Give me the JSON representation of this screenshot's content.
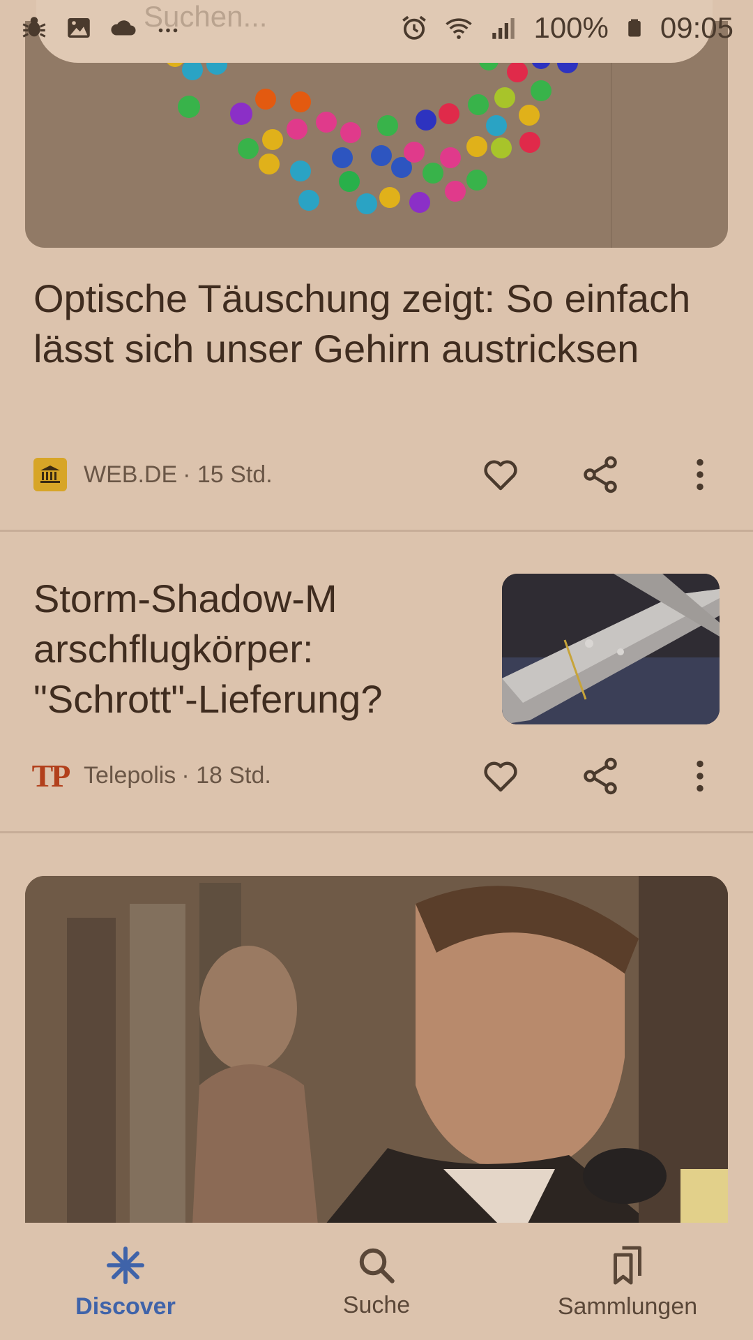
{
  "status_bar": {
    "battery": "100%",
    "time": "09:05"
  },
  "search": {
    "placeholder": "Suchen..."
  },
  "articles": [
    {
      "title": "Optische Täuschung zeigt: So einfach lässt sich unser Gehirn austricksen",
      "source": "WEB.DE",
      "age": "· 15 Std."
    },
    {
      "title": "Storm-Shadow-M arschflugkörper: \"Schrott\"-Lieferung?",
      "source": "Telepolis",
      "source_logo_text": "TP",
      "age": "· 18 Std."
    }
  ],
  "bottom_nav": {
    "items": [
      {
        "label": "Discover",
        "icon": "discover-asterisk-icon",
        "active": true
      },
      {
        "label": "Suche",
        "icon": "search-icon",
        "active": false
      },
      {
        "label": "Sammlungen",
        "icon": "bookmarks-icon",
        "active": false
      }
    ]
  },
  "colors": {
    "accent": "#3f63a9",
    "background": "#dcc3ad",
    "text": "#3f2c1f"
  }
}
